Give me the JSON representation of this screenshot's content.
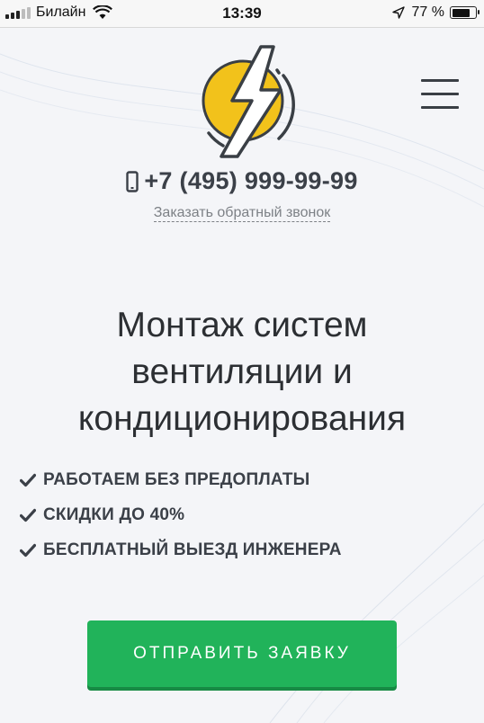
{
  "status_bar": {
    "carrier": "Билайн",
    "time": "13:39",
    "battery_percent": "77 %",
    "battery_level": 0.77,
    "signal_bars_active": 3,
    "signal_bars_total": 5
  },
  "header": {
    "logo_icon": "lightning-bolt-icon",
    "menu_icon": "hamburger-menu-icon",
    "phone": "+7 (495) 999-99-99",
    "callback_link": "Заказать обратный звонок"
  },
  "hero": {
    "headline_lines": [
      "Монтаж систем",
      "вентиляции и",
      "кондиционирования"
    ],
    "features": [
      "РАБОТАЕМ БЕЗ ПРЕДОПЛАТЫ",
      "СКИДКИ ДО 40%",
      "БЕСПЛАТНЫЙ ВЫЕЗД ИНЖЕНЕРА"
    ],
    "cta_label": "ОТПРАВИТЬ ЗАЯВКУ"
  },
  "colors": {
    "accent_green": "#21b35a",
    "logo_yellow": "#f2c21b",
    "text_dark": "#3b4048"
  }
}
